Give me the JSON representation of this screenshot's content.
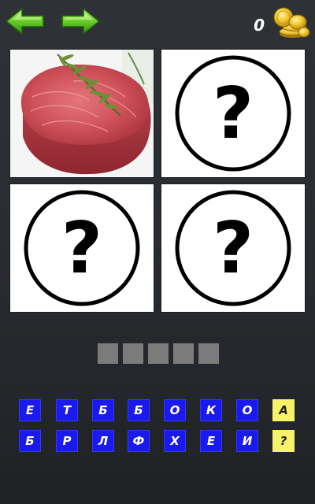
{
  "header": {
    "back_icon": "green-left-arrow-icon",
    "forward_icon": "green-right-arrow-icon",
    "coin_count": "0",
    "coins_icon": "gold-coins-icon"
  },
  "pictures": [
    {
      "content": "raw tuna steak with rosemary photo"
    },
    {
      "content": "question-mark-icon"
    },
    {
      "content": "question-mark-icon"
    },
    {
      "content": "question-mark-icon"
    }
  ],
  "answer": {
    "slot_count": 5
  },
  "letters": {
    "row1": [
      "Е",
      "Т",
      "Б",
      "Б",
      "О",
      "К",
      "О"
    ],
    "row2": [
      "Б",
      "Р",
      "Л",
      "Ф",
      "Х",
      "Е",
      "И"
    ],
    "reveal_letter_label": "А",
    "hint_label": "?"
  },
  "colors": {
    "letter_key_bg": "#1a1aee",
    "hint_key_bg": "#f6f26a",
    "slot_bg": "#7b7b7b",
    "background": "#2a2d31"
  }
}
